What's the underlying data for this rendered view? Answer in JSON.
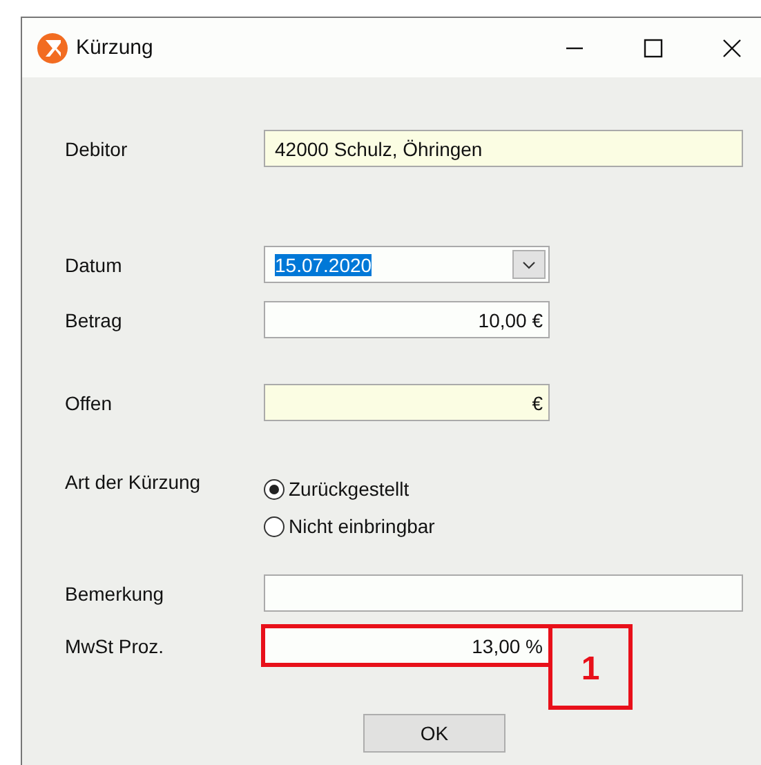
{
  "window": {
    "title": "Kürzung"
  },
  "rows": [
    {
      "kind": "text",
      "label": "Debitor",
      "value": "42000 Schulz, Öhringen",
      "readonly": true
    },
    {
      "kind": "combo",
      "label": "Datum",
      "value": "15.07.2020",
      "text_selected": true
    },
    {
      "kind": "text",
      "label": "Betrag",
      "value": "10,00 €",
      "readonly": false
    },
    {
      "kind": "text",
      "label": "Offen",
      "value": "€",
      "readonly": true
    },
    {
      "kind": "radio",
      "label": "Art der Kürzung",
      "options": [
        {
          "label": "Zurückgestellt",
          "selected": true
        },
        {
          "label": "Nicht einbringbar",
          "selected": false
        }
      ]
    },
    {
      "kind": "text",
      "label": "Bemerkung",
      "readonly": false
    },
    {
      "kind": "text",
      "label": "MwSt Proz.",
      "value": "13,00 %",
      "readonly": false,
      "callout": "1"
    }
  ],
  "buttons": [
    "OK"
  ]
}
